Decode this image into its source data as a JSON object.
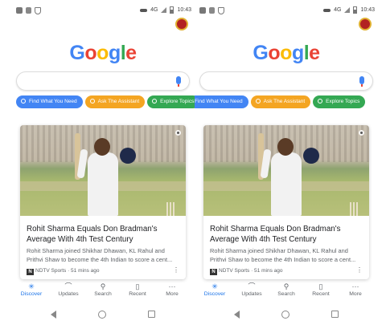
{
  "status_bar": {
    "network": "4G",
    "time": "10:43"
  },
  "logo": {
    "letters": [
      "G",
      "o",
      "o",
      "g",
      "l",
      "e"
    ],
    "colors": [
      "#4285f4",
      "#ea4335",
      "#fbbc05",
      "#4285f4",
      "#34a853",
      "#ea4335"
    ]
  },
  "search": {
    "placeholder": ""
  },
  "chips": [
    {
      "label": "Find What You Need",
      "color": "#4285f4"
    },
    {
      "label": "Ask The Assistant",
      "color": "#f4a522"
    },
    {
      "label": "Explore Topics",
      "color": "#34a853"
    }
  ],
  "card": {
    "headline": "Rohit Sharma Equals Don Bradman's Average With 4th Test Century",
    "snippet": "Rohit Sharma joined Shikhar Dhawan, KL Rahul and Prithvi Shaw to become the 4th Indian to score a cent...",
    "source_logo": "N",
    "source": "NDTV Sports · 51 mins ago",
    "menu": "⋮"
  },
  "bottom_nav": [
    {
      "label": "Discover",
      "icon": "asterisk-icon",
      "active": true
    },
    {
      "label": "Updates",
      "icon": "updates-icon",
      "active": false
    },
    {
      "label": "Search",
      "icon": "search-icon",
      "active": false
    },
    {
      "label": "Recent",
      "icon": "recent-icon",
      "active": false
    },
    {
      "label": "More",
      "icon": "more-icon",
      "active": false
    }
  ]
}
